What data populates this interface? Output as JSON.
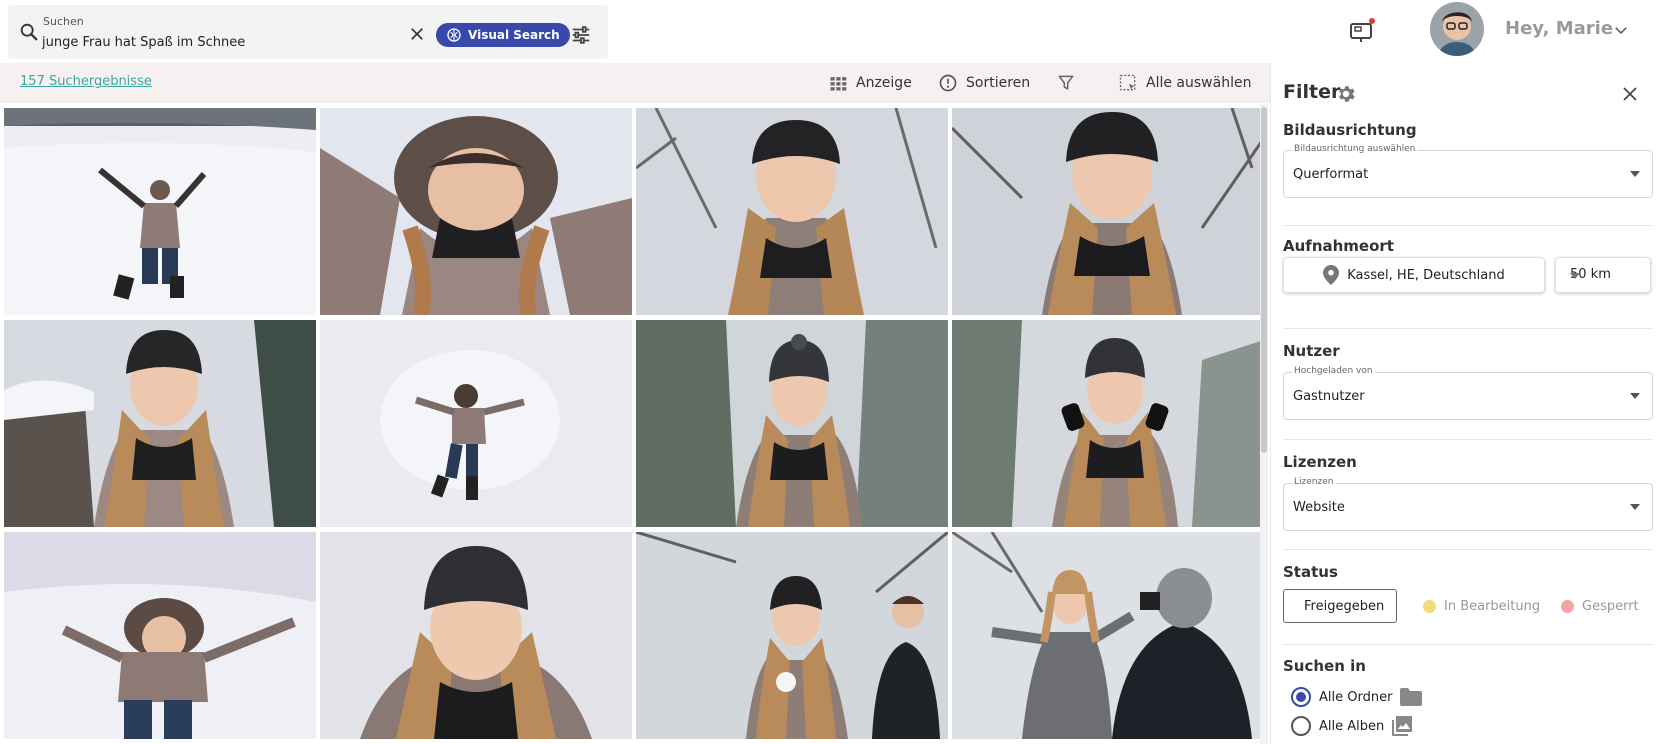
{
  "search": {
    "label": "Suchen",
    "query": "junge Frau hat Spaß im Schnee",
    "visual_search_label": "Visual Search"
  },
  "user": {
    "greeting": "Hey, Marie"
  },
  "toolbar": {
    "results_count": "157 Suchergebnisse",
    "display_label": "Anzeige",
    "sort_label": "Sortieren",
    "select_all_label": "Alle auswählen"
  },
  "results": [
    {
      "icon": "woman-snow-arms-raised"
    },
    {
      "icon": "woman-fur-hood-snow-angel"
    },
    {
      "icon": "woman-black-beanie-closeup"
    },
    {
      "icon": "woman-black-beanie-smiling"
    },
    {
      "icon": "woman-beanie-snowy-wall"
    },
    {
      "icon": "woman-snow-angel-top-view"
    },
    {
      "icon": "woman-snowy-beanie-forest"
    },
    {
      "icon": "woman-hands-on-hat"
    },
    {
      "icon": "woman-lying-snow-arms-out"
    },
    {
      "icon": "woman-snowy-beanie-portrait"
    },
    {
      "icon": "woman-with-snowball-and-boy"
    },
    {
      "icon": "woman-grey-coat-photographer"
    }
  ],
  "filter": {
    "title": "Filter",
    "orientation": {
      "title": "Bildausrichtung",
      "field_label": "Bildausrichtung auswählen",
      "value": "Querformat"
    },
    "location": {
      "title": "Aufnahmeort",
      "place": "Kassel, HE, Deutschland",
      "radius": "50 km"
    },
    "user": {
      "title": "Nutzer",
      "field_label": "Hochgeladen von",
      "value": "Gastnutzer"
    },
    "license": {
      "title": "Lizenzen",
      "field_label": "Lizenzen",
      "value": "Website"
    },
    "status": {
      "title": "Status",
      "options": [
        {
          "label": "Freigegeben",
          "color": "#2fbf3a"
        },
        {
          "label": "In Bearbeitung",
          "color": "#f1dc7a"
        },
        {
          "label": "Gesperrt",
          "color": "#f4a3a8"
        }
      ]
    },
    "search_in": {
      "title": "Suchen in",
      "options": [
        {
          "label": "Alle Ordner",
          "selected": true
        },
        {
          "label": "Alle Alben",
          "selected": false
        }
      ]
    }
  },
  "colors": {
    "accent": "#3949ab",
    "link": "#3ba6a0",
    "toolbar_bg": "#f7f0f0"
  }
}
